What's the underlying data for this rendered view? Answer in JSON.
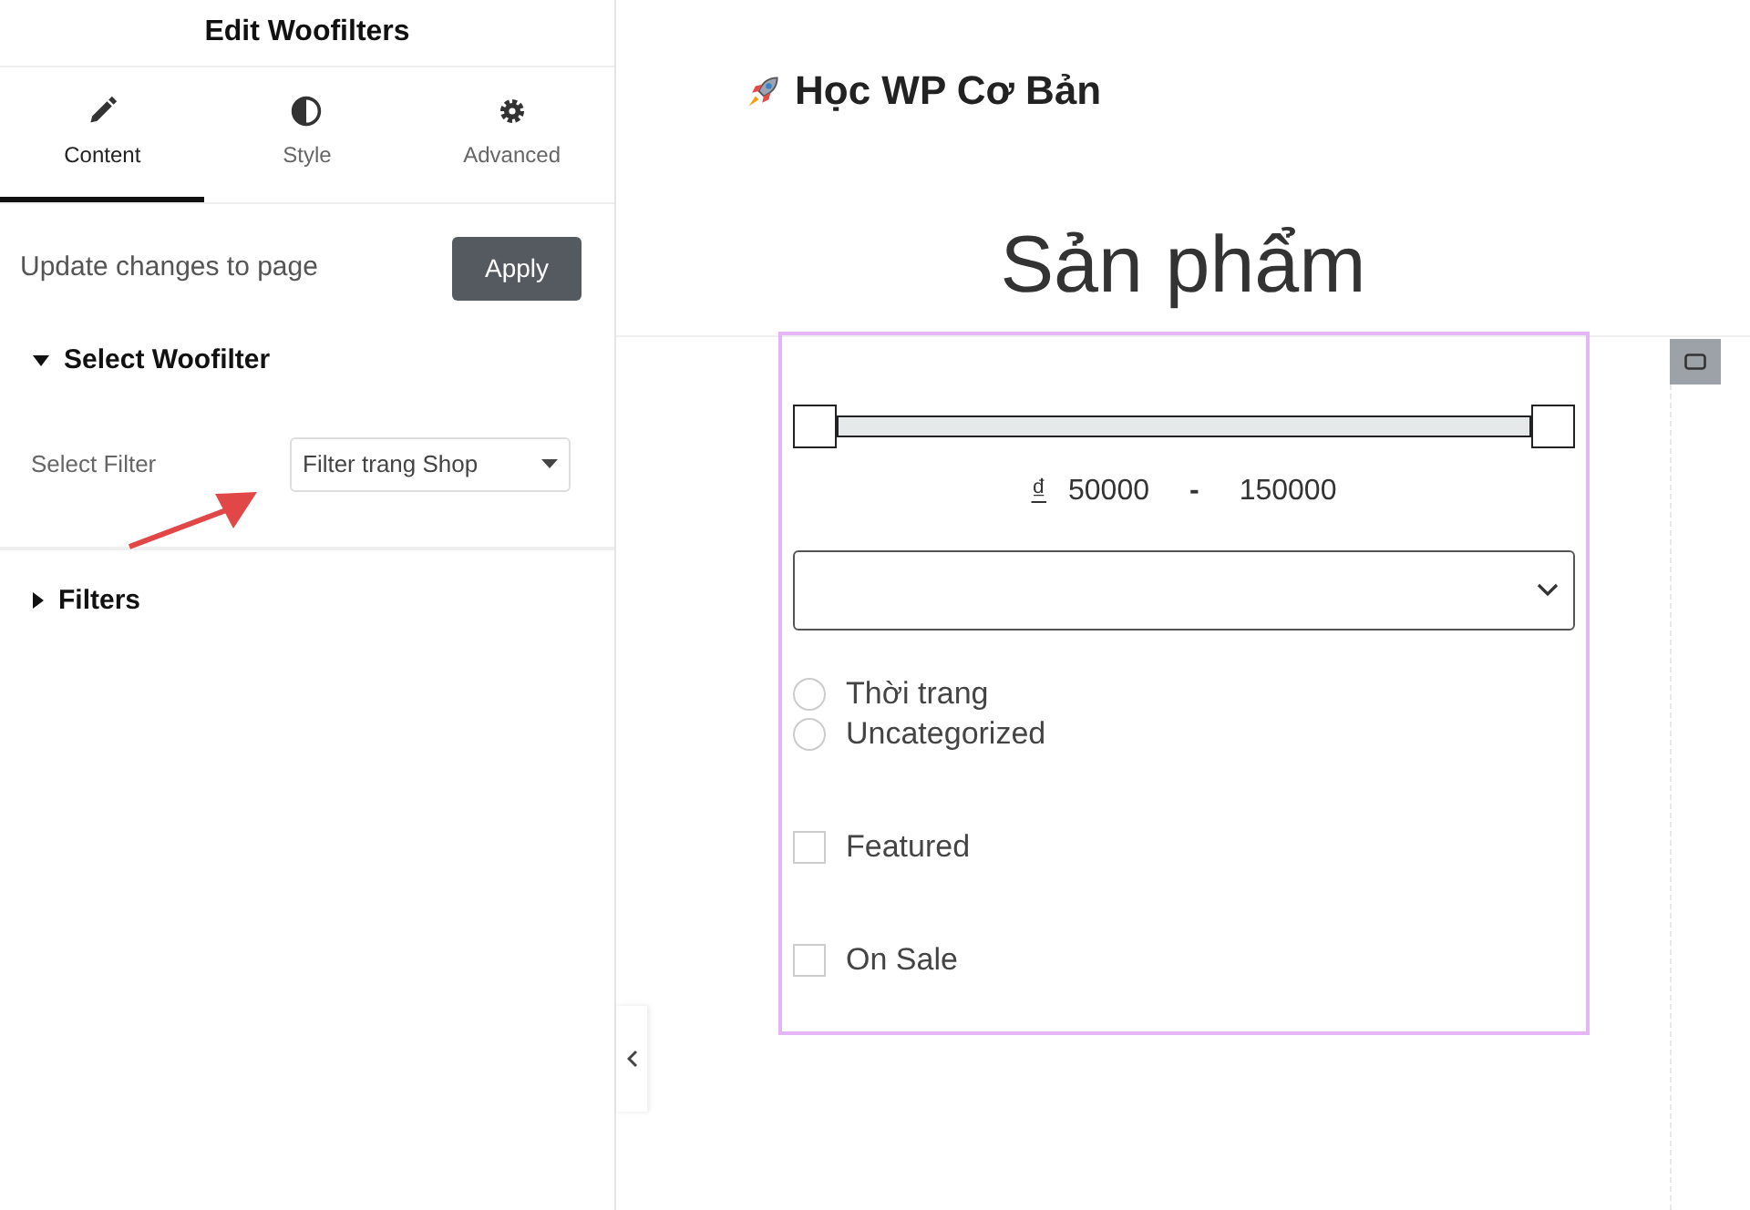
{
  "panel": {
    "title": "Edit Woofilters",
    "tabs": [
      {
        "label": "Content",
        "selected": true
      },
      {
        "label": "Style",
        "selected": false
      },
      {
        "label": "Advanced",
        "selected": false
      }
    ],
    "update": {
      "text": "Update changes to page",
      "button": "Apply"
    },
    "sections": [
      {
        "title": "Select Woofilter",
        "expanded": true,
        "field": {
          "label": "Select Filter",
          "value": "Filter trang Shop"
        }
      },
      {
        "title": "Filters",
        "expanded": false
      }
    ]
  },
  "preview": {
    "site_title": "Học WP Cơ Bản",
    "heading": "Sản phẩm",
    "filter": {
      "range": {
        "level": 1,
        "currency": "₫",
        "min": "50000",
        "separator": "-",
        "max": "150000"
      },
      "options": [
        {
          "kind": "radio",
          "label": "Thời trang",
          "selected": false
        },
        {
          "kind": "radio",
          "label": "Uncategorized",
          "selected": false
        },
        {
          "kind": "checkbox",
          "label": "Featured",
          "checked": false
        },
        {
          "kind": "checkbox",
          "label": "On Sale",
          "checked": false
        }
      ]
    }
  }
}
